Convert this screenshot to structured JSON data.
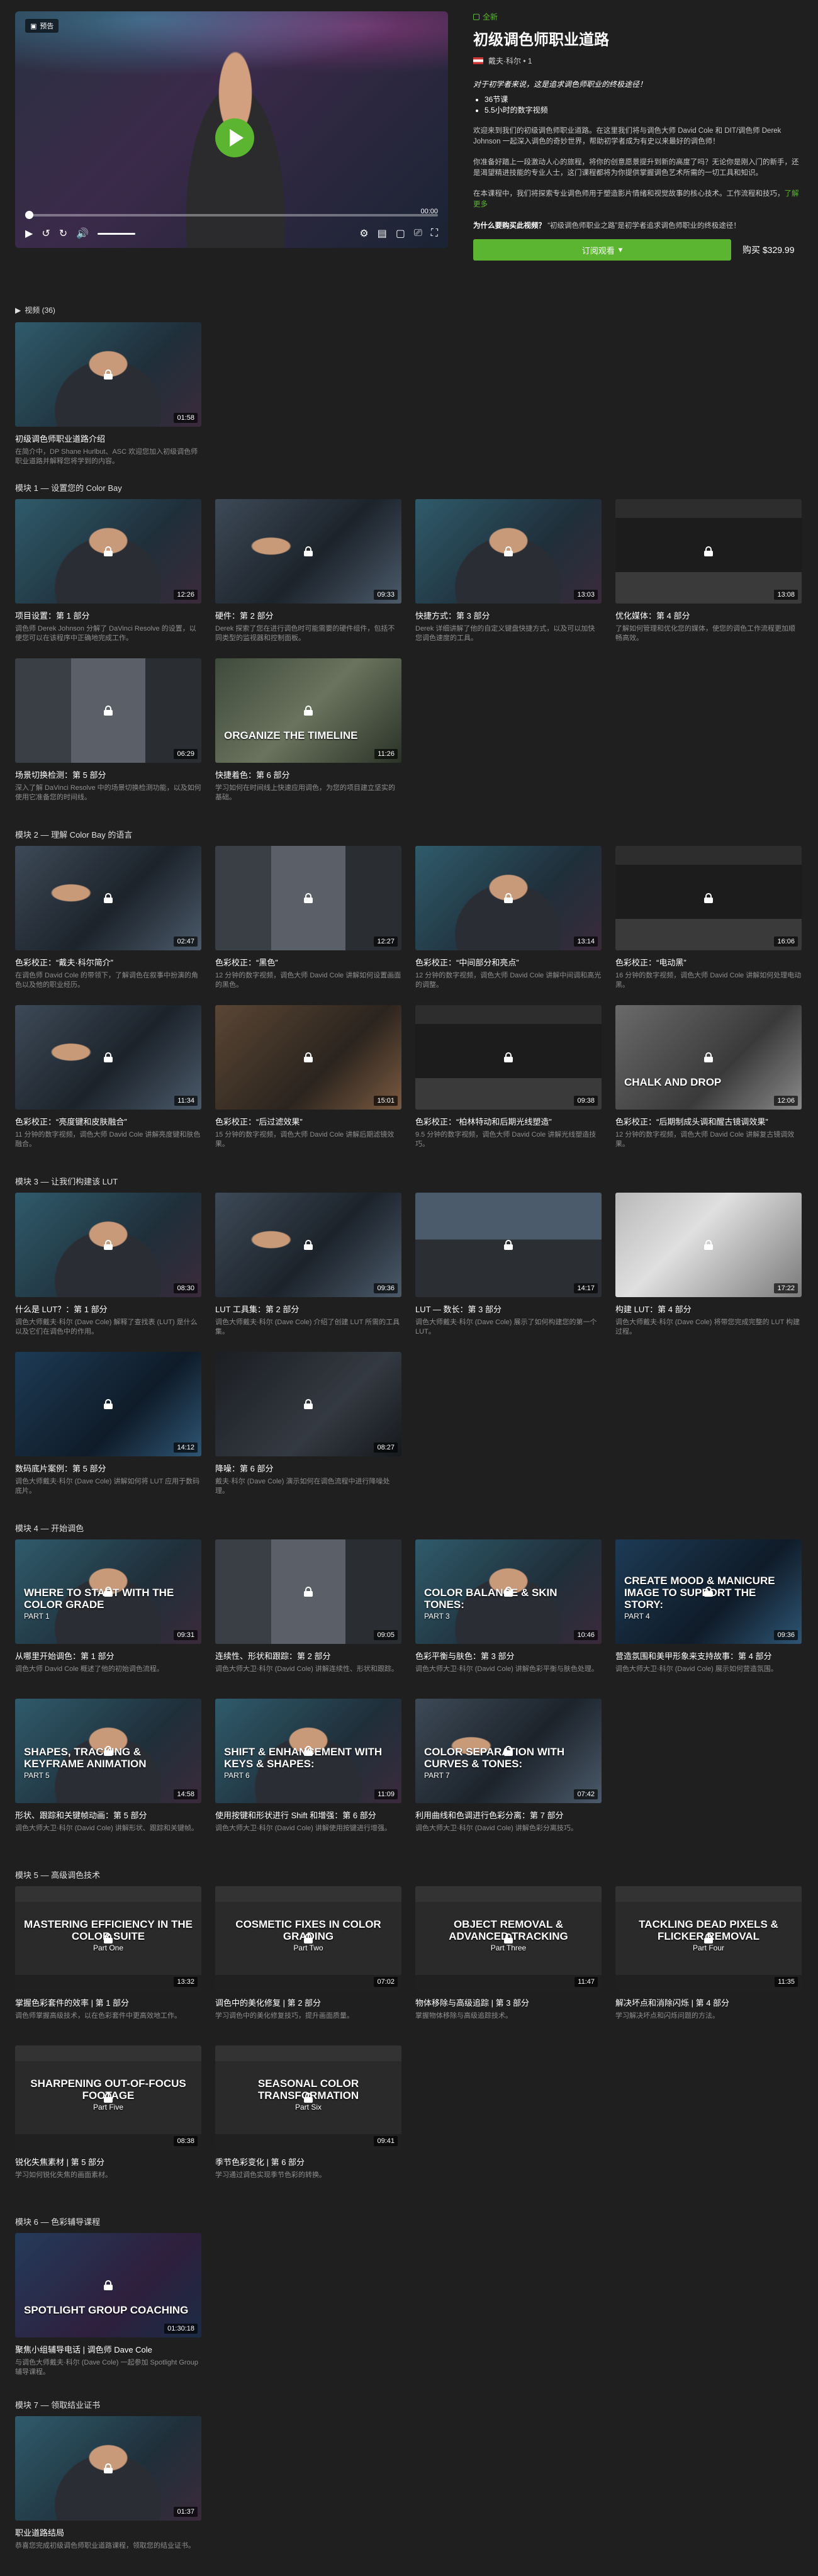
{
  "preview_label": "预告",
  "video": {
    "time_end": "00:00"
  },
  "course": {
    "tag": "全新",
    "title": "初级调色师职业道路",
    "author": "戴夫·科尔 • 1",
    "tagline": "对于初学者来说，这是追求调色师职业的终极途径！",
    "bullets": [
      "36节课",
      "5.5小时的数字视频"
    ],
    "desc1": "欢迎来到我们的初级调色师职业道路。在这里我们将与调色大师 David Cole 和 DIT/调色师 Derek Johnson 一起深入调色的奇妙世界，帮助初学者成为有史以来最好的调色师！",
    "desc2": "你准备好踏上一段激动人心的旅程，将你的创意愿景提升到新的高度了吗？无论你是刚入门的新手，还是渴望精进技能的专业人士，这门课程都将为你提供掌握调色艺术所需的一切工具和知识。",
    "desc3": "在本课程中，我们将探索专业调色师用于塑造影片情绪和视觉故事的核心技术。工作流程和技巧，",
    "more": "了解更多",
    "why_label": "为什么要购买此视频？",
    "why_text": "“初级调色师职业之路”是初学者追求调色师职业的终极途径！",
    "subscribe_label": "订阅观看",
    "buy_label": "购买 $329.99"
  },
  "list": {
    "title": "视频 (36)"
  },
  "intro": {
    "title": "初级调色师职业道路介绍",
    "desc": "在简介中，DP Shane Hurlbut、ASC 欢迎您加入初级调色师职业道路并解释您将学到的内容。",
    "duration": "01:58"
  },
  "modules": [
    {
      "title": "模块 1 — 设置您的 Color Bay",
      "cards": [
        {
          "title": "项目设置：第 1 部分",
          "desc": "调色师 Derek Johnson 分解了 DaVinci Resolve 的设置，以便您可以在该程序中正确地完成工作。",
          "duration": "12:26"
        },
        {
          "title": "硬件：第 2 部分",
          "desc": "Derek 探索了您在进行调色时可能需要的硬件组件，包括不同类型的监视器和控制面板。",
          "duration": "09:33"
        },
        {
          "title": "快捷方式：第 3 部分",
          "desc": "Derek 详细讲解了他的自定义键盘快捷方式，以及可以加快您调色速度的工具。",
          "duration": "13:03"
        },
        {
          "title": "优化媒体：第 4 部分",
          "desc": "了解如何管理和优化您的媒体，使您的调色工作流程更加顺畅高效。",
          "duration": "13:08"
        },
        {
          "title": "场景切换检测：第 5 部分",
          "desc": "深入了解 DaVinci Resolve 中的场景切换检测功能，以及如何使用它准备您的时间线。",
          "duration": "06:29"
        },
        {
          "title": "快捷着色：第 6 部分",
          "desc": "学习如何在时间线上快速应用调色，为您的项目建立坚实的基础。",
          "duration": "11:26",
          "overlay": "ORGANIZE THE TIMELINE"
        }
      ]
    },
    {
      "title": "模块 2 — 理解 Color Bay 的语言",
      "cards": [
        {
          "title": "色彩校正：“戴夫·科尔简介”",
          "desc": "在调色师 David Cole 的带领下，了解调色在叙事中扮演的角色以及他的职业经历。",
          "duration": "02:47"
        },
        {
          "title": "色彩校正：“黑色”",
          "desc": "12 分钟的数字视频，调色大师 David Cole 讲解如何设置画面的黑色。",
          "duration": "12:27"
        },
        {
          "title": "色彩校正：“中间部分和亮点”",
          "desc": "12 分钟的数字视频，调色大师 David Cole 讲解中间调和高光的调整。",
          "duration": "13:14"
        },
        {
          "title": "色彩校正：“电动黑”",
          "desc": "16 分钟的数字视频，调色大师 David Cole 讲解如何处理电动黑。",
          "duration": "16:06"
        },
        {
          "title": "色彩校正：“亮度键和皮肤融合”",
          "desc": "11 分钟的数字视频，调色大师 David Cole 讲解亮度键和肤色融合。",
          "duration": "11:34"
        },
        {
          "title": "色彩校正：“后过滤效果”",
          "desc": "15 分钟的数字视频，调色大师 David Cole 讲解后期滤镜效果。",
          "duration": "15:01"
        },
        {
          "title": "色彩校正：“柏林特动和后期光线塑造”",
          "desc": "9.5 分钟的数字视频，调色大师 David Cole 讲解光线塑造技巧。",
          "duration": "09:38"
        },
        {
          "title": "色彩校正：“后期制成头调和醒古镜调效果”",
          "desc": "12 分钟的数字视频，调色大师 David Cole 讲解复古镜调效果。",
          "duration": "12:06",
          "overlay": "CHALK AND DROP"
        }
      ]
    },
    {
      "title": "模块 3 — 让我们构建该 LUT",
      "cards": [
        {
          "title": "什么是 LUT？：第 1 部分",
          "desc": "调色大师戴夫·科尔 (Dave Cole) 解释了查找表 (LUT) 是什么以及它们在调色中的作用。",
          "duration": "08:30"
        },
        {
          "title": "LUT 工具集：第 2 部分",
          "desc": "调色大师戴夫·科尔 (Dave Cole) 介绍了创建 LUT 所需的工具集。",
          "duration": "09:36"
        },
        {
          "title": "LUT — 数长：第 3 部分",
          "desc": "调色大师戴夫·科尔 (Dave Cole) 展示了如何构建您的第一个 LUT。",
          "duration": "14:17"
        },
        {
          "title": "构建 LUT：第 4 部分",
          "desc": "调色大师戴夫·科尔 (Dave Cole) 将带您完成完整的 LUT 构建过程。",
          "duration": "17:22"
        },
        {
          "title": "数码底片案例：第 5 部分",
          "desc": "调色大师戴夫·科尔 (Dave Cole) 讲解如何将 LUT 应用于数码底片。",
          "duration": "14:12"
        },
        {
          "title": "降噪：第 6 部分",
          "desc": "戴夫·科尔 (Dave Cole) 演示如何在调色流程中进行降噪处理。",
          "duration": "08:27"
        }
      ]
    },
    {
      "title": "模块 4 — 开始调色",
      "cards": [
        {
          "title": "从哪里开始调色：第 1 部分",
          "desc": "调色大师 David Cole 概述了他的初始调色流程。",
          "duration": "09:31",
          "overlay": "WHERE TO START WITH THE COLOR GRADE",
          "sub": "PART 1"
        },
        {
          "title": "连续性、形状和跟踪：第 2 部分",
          "desc": "调色大师大卫·科尔 (David Cole) 讲解连续性、形状和跟踪。",
          "duration": "09:05"
        },
        {
          "title": "色彩平衡与肤色：第 3 部分",
          "desc": "调色大师大卫·科尔 (David Cole) 讲解色彩平衡与肤色处理。",
          "duration": "10:46",
          "overlay": "COLOR BALANCE & SKIN TONES:",
          "sub": "PART 3"
        },
        {
          "title": "营造氛围和美甲形象来支持故事：第 4 部分",
          "desc": "调色大师大卫·科尔 (David Cole) 展示如何营造氛围。",
          "duration": "09:36",
          "overlay": "CREATE MOOD & MANICURE IMAGE TO SUPPORT THE STORY:",
          "sub": "PART 4"
        },
        {
          "title": "形状、跟踪和关键帧动画：第 5 部分",
          "desc": "调色大师大卫·科尔 (David Cole) 讲解形状、跟踪和关键帧。",
          "duration": "14:58",
          "overlay": "SHAPES, TRACKING & KEYFRAME ANIMATION",
          "sub": "PART 5"
        },
        {
          "title": "使用按键和形状进行 Shift 和增强：第 6 部分",
          "desc": "调色大师大卫·科尔 (David Cole) 讲解使用按键进行增强。",
          "duration": "11:09",
          "overlay": "SHIFT & ENHANCEMENT WITH KEYS & SHAPES:",
          "sub": "PART 6"
        },
        {
          "title": "利用曲线和色调进行色彩分离：第 7 部分",
          "desc": "调色大师大卫·科尔 (David Cole) 讲解色彩分离技巧。",
          "duration": "07:42",
          "overlay": "COLOR SEPARATION WITH CURVES & TONES:",
          "sub": "PART 7"
        }
      ]
    },
    {
      "title": "模块 5 — 高级调色技术",
      "cards": [
        {
          "title": "掌握色彩套件的效率 | 第 1 部分",
          "desc": "调色师掌握高级技术，以在色彩套件中更高效地工作。",
          "duration": "13:32",
          "overlay": "MASTERING EFFICIENCY IN THE COLOR SUITE",
          "sub": "Part One"
        },
        {
          "title": "调色中的美化修复 | 第 2 部分",
          "desc": "学习调色中的美化修复技巧，提升画面质量。",
          "duration": "07:02",
          "overlay": "COSMETIC FIXES IN COLOR GRADING",
          "sub": "Part Two"
        },
        {
          "title": "物体移除与高级追踪 | 第 3 部分",
          "desc": "掌握物体移除与高级追踪技术。",
          "duration": "11:47",
          "overlay": "OBJECT REMOVAL & ADVANCED TRACKING",
          "sub": "Part Three"
        },
        {
          "title": "解决坏点和消除闪烁 | 第 4 部分",
          "desc": "学习解决坏点和闪烁问题的方法。",
          "duration": "11:35",
          "overlay": "TACKLING DEAD PIXELS & FLICKER REMOVAL",
          "sub": "Part Four"
        },
        {
          "title": "锐化失焦素材 | 第 5 部分",
          "desc": "学习如何锐化失焦的画面素材。",
          "duration": "08:38",
          "overlay": "SHARPENING OUT-OF-FOCUS FOOTAGE",
          "sub": "Part Five"
        },
        {
          "title": "季节色彩变化 | 第 6 部分",
          "desc": "学习通过调色实现季节色彩的转换。",
          "duration": "09:41",
          "overlay": "SEASONAL COLOR TRANSFORMATION",
          "sub": "Part Six"
        }
      ]
    },
    {
      "title": "模块 6 — 色彩辅导课程",
      "cards": [
        {
          "title": "聚焦小组辅导电话 | 调色师 Dave Cole",
          "desc": "与调色大师戴夫·科尔 (Dave Cole) 一起参加 Spotlight Group 辅导课程。",
          "duration": "01:30:18",
          "overlay": "Spotlight Group Coaching"
        }
      ]
    },
    {
      "title": "模块 7 — 领取结业证书",
      "cards": [
        {
          "title": "职业道路结局",
          "desc": "恭喜您完成初级调色师职业道路课程，领取您的结业证书。",
          "duration": "01:37"
        }
      ]
    }
  ]
}
